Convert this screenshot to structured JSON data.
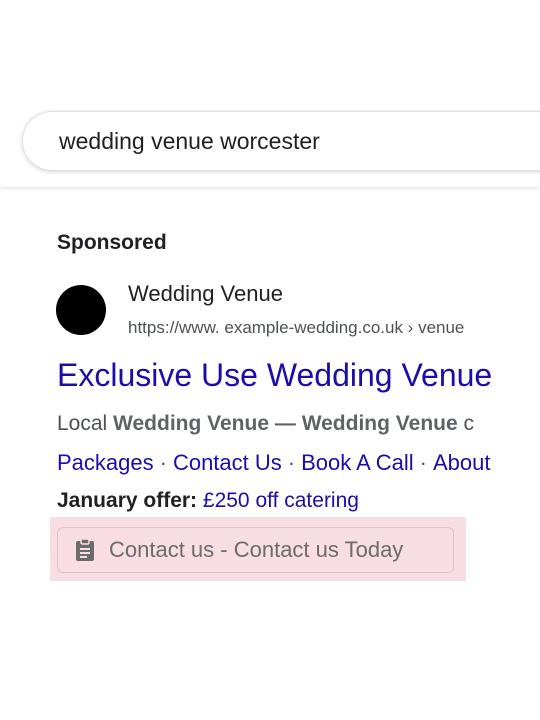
{
  "search": {
    "query": "wedding venue worcester"
  },
  "ad": {
    "sponsored_label": "Sponsored",
    "advertiser_name": "Wedding Venue",
    "display_url": "https://www. example-wedding.co.uk › venue",
    "title": "Exclusive Use Wedding Venue",
    "description": {
      "prefix": "Local ",
      "bold1": "Wedding Venue",
      "middle": " — ",
      "bold2": "Wedding Venue",
      "suffix": " c"
    },
    "sitelinks": [
      {
        "label": "Packages"
      },
      {
        "label": "Contact Us"
      },
      {
        "label": "Book A Call"
      },
      {
        "label": "About"
      }
    ],
    "sitelink_separator": "·",
    "offer": {
      "label": "January offer:",
      "value": "£250 off catering"
    },
    "lead_form": {
      "label": "Contact us - Contact us Today",
      "icon": "clipboard-icon"
    }
  },
  "colors": {
    "link": "#1a0dab",
    "highlight": "#f9dde5"
  }
}
